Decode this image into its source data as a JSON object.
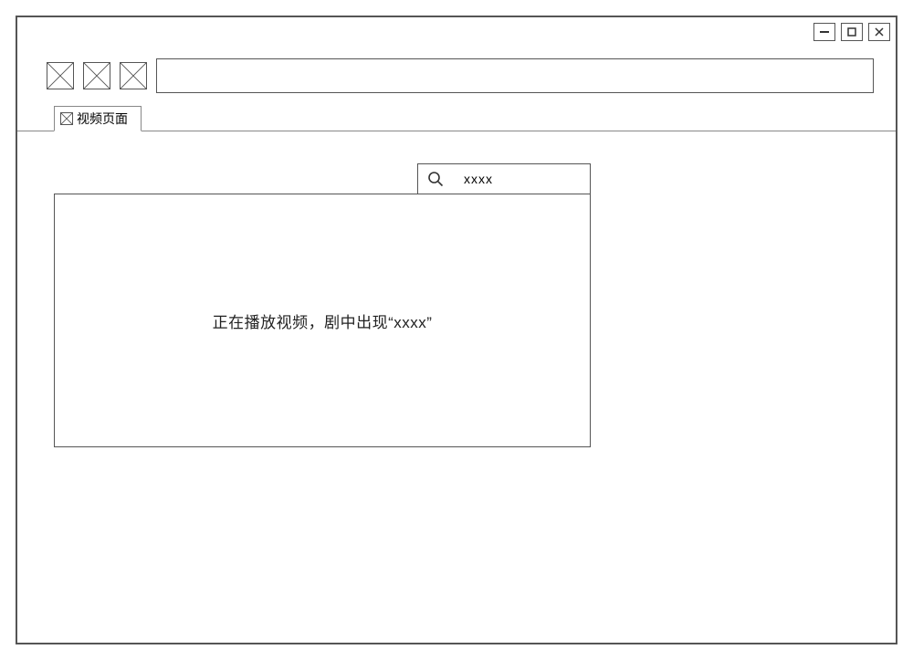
{
  "window": {
    "minimize_icon": "minimize",
    "maximize_icon": "maximize",
    "close_icon": "close"
  },
  "tab": {
    "label": "视频页面"
  },
  "search": {
    "value": "xxxx"
  },
  "video": {
    "status_text": "正在播放视频，剧中出现“xxxx”"
  }
}
